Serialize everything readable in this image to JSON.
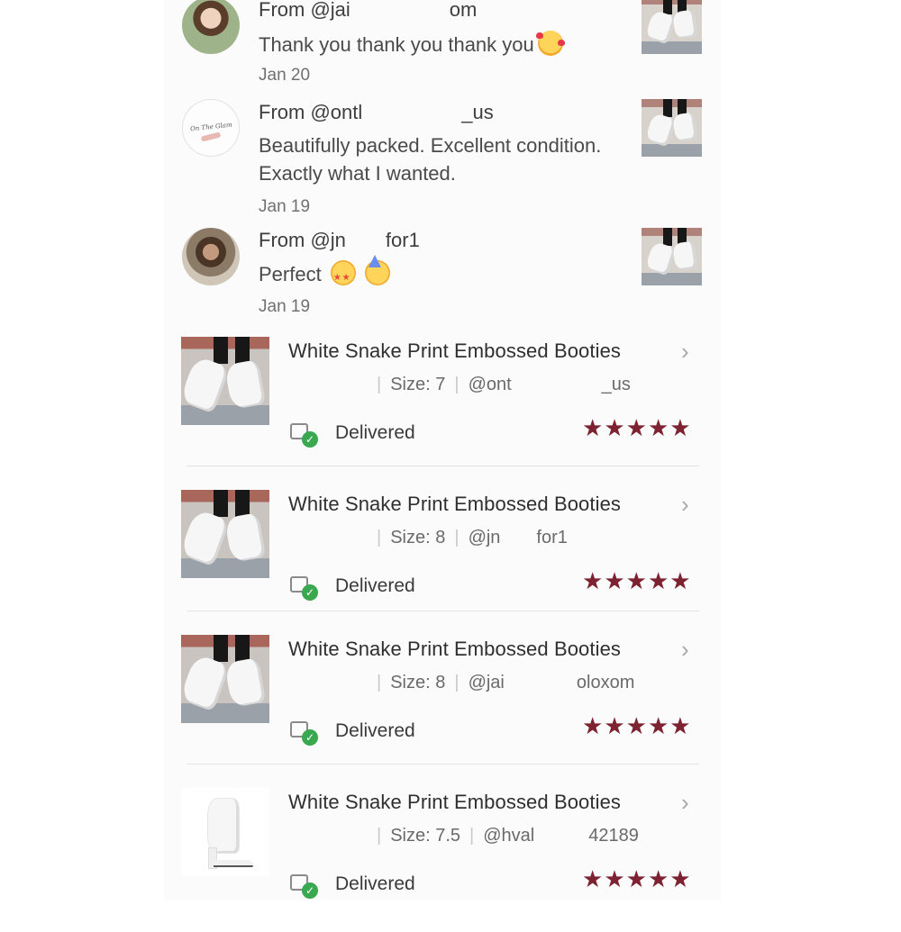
{
  "reviews": [
    {
      "from": "From @jai     om",
      "text": "Thank you thank you thank you",
      "emoji": [
        "smiling-face-with-hearts"
      ],
      "date": "Jan 20"
    },
    {
      "from": "From @ontl     _us",
      "text": "Beautifully packed. Excellent condition. Exactly what I wanted.",
      "emoji": [],
      "date": "Jan 19"
    },
    {
      "from": "From @jn  for1",
      "text": "Perfect",
      "emoji": [
        "star-struck",
        "partying-face"
      ],
      "date": "Jan 19"
    }
  ],
  "orders": [
    {
      "title": "White Snake Print Embossed Booties",
      "size": "Size: 7",
      "user": "@ont     _us",
      "status": "Delivered",
      "rating": 5,
      "image": "boots-model"
    },
    {
      "title": "White Snake Print Embossed Booties",
      "size": "Size: 8",
      "user": "@jn  for1",
      "status": "Delivered",
      "rating": 5,
      "image": "boots-model"
    },
    {
      "title": "White Snake Print Embossed Booties",
      "size": "Size: 8",
      "user": "@jai    oloxom",
      "status": "Delivered",
      "rating": 5,
      "image": "boots-model"
    },
    {
      "title": "White Snake Print Embossed Booties",
      "size": "Size: 7.5",
      "user": "@hval   42189",
      "status": "Delivered",
      "rating": 5,
      "image": "boot-product"
    }
  ],
  "icons": {
    "chevron": "chevron-right-icon",
    "delivered": "delivered-check-icon",
    "star": "star-icon"
  },
  "colors": {
    "star": "#7c2230",
    "check": "#3aa84f",
    "text": "#3a3a3a"
  }
}
